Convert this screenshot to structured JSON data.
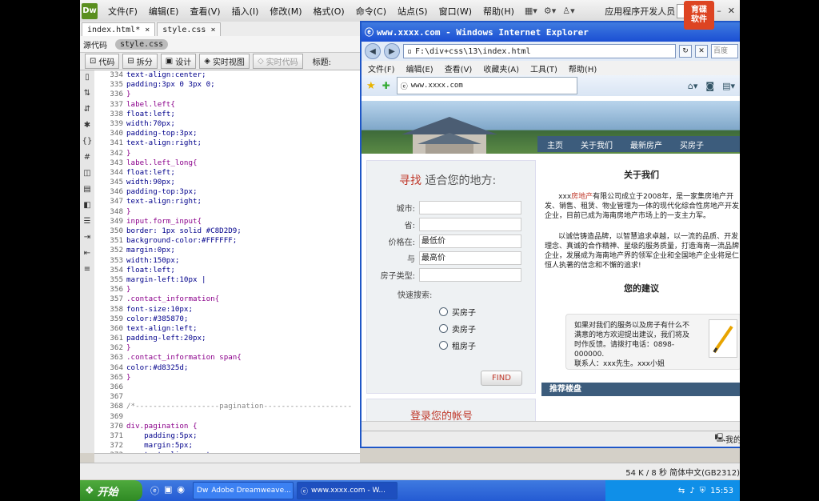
{
  "dreamweaver": {
    "logo": "Dw",
    "menus": [
      "文件(F)",
      "编辑(E)",
      "查看(V)",
      "插入(I)",
      "修改(M)",
      "格式(O)",
      "命令(C)",
      "站点(S)",
      "窗口(W)",
      "帮助(H)"
    ],
    "workspace": "应用程序开发人员",
    "brand_line1": "育碟",
    "brand_line2": "软件",
    "tabs": [
      {
        "label": "index.html*",
        "close": "×"
      },
      {
        "label": "style.css",
        "close": "×"
      }
    ],
    "related_files": [
      "源代码",
      "style.css"
    ],
    "toolbar": {
      "code": "代码",
      "split": "拆分",
      "design": "设计",
      "live_view": "实时视图",
      "live_code": "实时代码",
      "title_label": "标题:"
    },
    "status": "54 K / 8 秒  简体中文(GB2312)"
  },
  "code_lines": [
    {
      "n": "334",
      "t": "text-align:center;",
      "c": "prop"
    },
    {
      "n": "335",
      "t": "padding:3px 0 3px 0;",
      "c": "prop"
    },
    {
      "n": "336",
      "t": "}",
      "c": "brace"
    },
    {
      "n": "337",
      "t": "label.left{",
      "c": "sel"
    },
    {
      "n": "338",
      "t": "float:left;",
      "c": "prop"
    },
    {
      "n": "339",
      "t": "width:70px;",
      "c": "prop"
    },
    {
      "n": "340",
      "t": "padding-top:3px;",
      "c": "prop"
    },
    {
      "n": "341",
      "t": "text-align:right;",
      "c": "prop"
    },
    {
      "n": "342",
      "t": "}",
      "c": "brace"
    },
    {
      "n": "343",
      "t": "label.left_long{",
      "c": "sel"
    },
    {
      "n": "344",
      "t": "float:left;",
      "c": "prop"
    },
    {
      "n": "345",
      "t": "width:90px;",
      "c": "prop"
    },
    {
      "n": "346",
      "t": "padding-top:3px;",
      "c": "prop"
    },
    {
      "n": "347",
      "t": "text-align:right;",
      "c": "prop"
    },
    {
      "n": "348",
      "t": "}",
      "c": "brace"
    },
    {
      "n": "349",
      "t": "input.form_input{",
      "c": "sel"
    },
    {
      "n": "350",
      "t": "border: 1px solid #C8D2D9;",
      "c": "prop"
    },
    {
      "n": "351",
      "t": "background-color:#FFFFFF;",
      "c": "prop"
    },
    {
      "n": "352",
      "t": "margin:0px;",
      "c": "prop"
    },
    {
      "n": "353",
      "t": "width:150px;",
      "c": "prop"
    },
    {
      "n": "354",
      "t": "float:left;",
      "c": "prop"
    },
    {
      "n": "355",
      "t": "margin-left:10px |",
      "c": "prop"
    },
    {
      "n": "356",
      "t": "}",
      "c": "brace"
    },
    {
      "n": "357",
      "t": ".contact_information{",
      "c": "sel"
    },
    {
      "n": "358",
      "t": "font-size:10px;",
      "c": "prop"
    },
    {
      "n": "359",
      "t": "color:#385870;",
      "c": "prop"
    },
    {
      "n": "360",
      "t": "text-align:left;",
      "c": "prop"
    },
    {
      "n": "361",
      "t": "padding-left:20px;",
      "c": "prop"
    },
    {
      "n": "362",
      "t": "}",
      "c": "brace"
    },
    {
      "n": "363",
      "t": ".contact_information span{",
      "c": "sel"
    },
    {
      "n": "364",
      "t": "color:#d8325d;",
      "c": "prop"
    },
    {
      "n": "365",
      "t": "}",
      "c": "brace"
    },
    {
      "n": "366",
      "t": "",
      "c": "prop"
    },
    {
      "n": "367",
      "t": "",
      "c": "prop"
    },
    {
      "n": "368",
      "t": "/*-------------------pagination--------------------",
      "c": "cmt"
    },
    {
      "n": "369",
      "t": "",
      "c": "prop"
    },
    {
      "n": "370",
      "t": "div.pagination {",
      "c": "sel"
    },
    {
      "n": "371",
      "t": "    padding:5px;",
      "c": "prop"
    },
    {
      "n": "372",
      "t": "    margin:5px;",
      "c": "prop"
    },
    {
      "n": "373",
      "t": "    text-align:center;",
      "c": "prop"
    }
  ],
  "ie": {
    "title": "www.xxxx.com - Windows Internet Explorer",
    "address": "F:\\div+css\\13\\index.html",
    "search_placeholder": "百度",
    "menus": [
      "文件(F)",
      "编辑(E)",
      "查看(V)",
      "收藏夹(A)",
      "工具(T)",
      "帮助(H)"
    ],
    "tab_label": "www.xxxx.com",
    "status": "我的"
  },
  "site": {
    "nav": [
      "主页",
      "关于我们",
      "最新房产",
      "买房子"
    ],
    "search_title_red": "寻找",
    "search_title_rest": "适合您的地方:",
    "fields": [
      {
        "label": "城市:",
        "value": ""
      },
      {
        "label": "省:",
        "value": ""
      },
      {
        "label": "价格在:",
        "value": "最低价"
      },
      {
        "label": "与",
        "value": "最高价"
      },
      {
        "label": "房子类型:",
        "value": ""
      }
    ],
    "quick_search": "快速搜索:",
    "radios": [
      "买房子",
      "卖房子",
      "租房子"
    ],
    "find_button": "FIND",
    "login_title": "登录您的帐号",
    "about_title": "关于我们",
    "about_p1_a": "xxx",
    "about_p1_link": "房地产",
    "about_p1_b": "有限公司成立于2008年，是一家集房地产开发、销售、租赁、物业管理为一体的现代化综合性房地产开发企业，目前已成为海南房地产市场上的一支主力军。",
    "about_p2": "以诚信铸造品牌，以智慧追求卓越，以一流的品质、开发理念、真诚的合作精神、星级的服务质量，打造海南一流品牌企业，发展成为海南地产界的领军企业和全国地产企业将是仁恒人执著的信念和不懈的追求!",
    "suggest_title": "您的建议",
    "suggest_text": "如果对我们的服务以及房子有什么不满意的地方欢迎提出建议，我们将及时作反馈。请拨打电话：0898-000000.",
    "suggest_contact": "联系人：xxx先生。xxx小姐",
    "recommend": "推荐楼盘"
  },
  "taskbar": {
    "start": "开始",
    "tasks": [
      "Adobe Dreamweave...",
      "www.xxxx.com - W..."
    ],
    "time": "15:53"
  }
}
